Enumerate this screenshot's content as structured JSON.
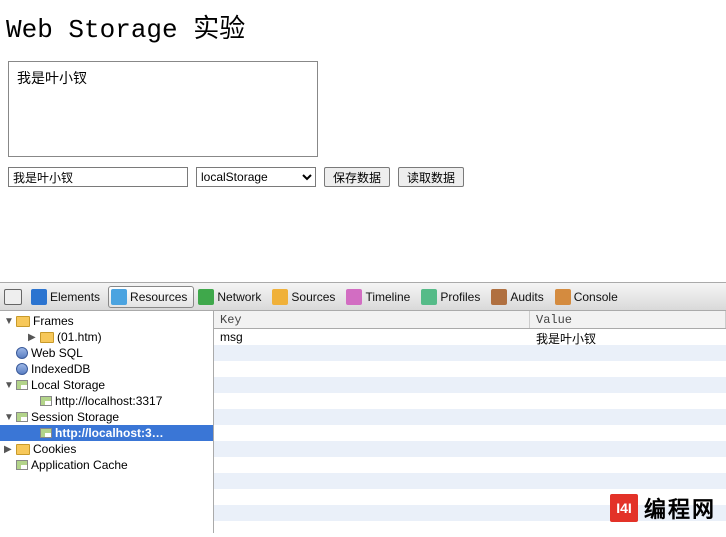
{
  "page": {
    "heading": "Web Storage 实验",
    "textarea_value": "我是叶小钗",
    "input_value": "我是叶小钗",
    "select_value": "localStorage",
    "save_label": "保存数据",
    "read_label": "读取数据"
  },
  "devtools": {
    "tabs": [
      {
        "label": "Elements"
      },
      {
        "label": "Resources"
      },
      {
        "label": "Network"
      },
      {
        "label": "Sources"
      },
      {
        "label": "Timeline"
      },
      {
        "label": "Profiles"
      },
      {
        "label": "Audits"
      },
      {
        "label": "Console"
      }
    ],
    "active_tab": "Resources",
    "tab_icon_colors": [
      "#2b74d0",
      "#4aa3e0",
      "#3fa84b",
      "#f0b13a",
      "#d26dc2",
      "#55bb88",
      "#b07040",
      "#d48b3f"
    ],
    "tree": {
      "frames": {
        "label": "Frames",
        "file": "(01.htm)"
      },
      "websql": "Web SQL",
      "indexeddb": "IndexedDB",
      "local_storage": {
        "label": "Local Storage",
        "children": [
          "http://localhost:3317"
        ]
      },
      "session_storage": {
        "label": "Session Storage",
        "children": [
          "http://localhost:3…"
        ]
      },
      "cookies": "Cookies",
      "appcache": "Application Cache"
    },
    "columns": {
      "key": "Key",
      "value": "Value"
    },
    "entries": [
      {
        "key": "msg",
        "value": "我是叶小钗"
      }
    ]
  },
  "watermark": {
    "logo": "I4I",
    "text": "编程网"
  }
}
